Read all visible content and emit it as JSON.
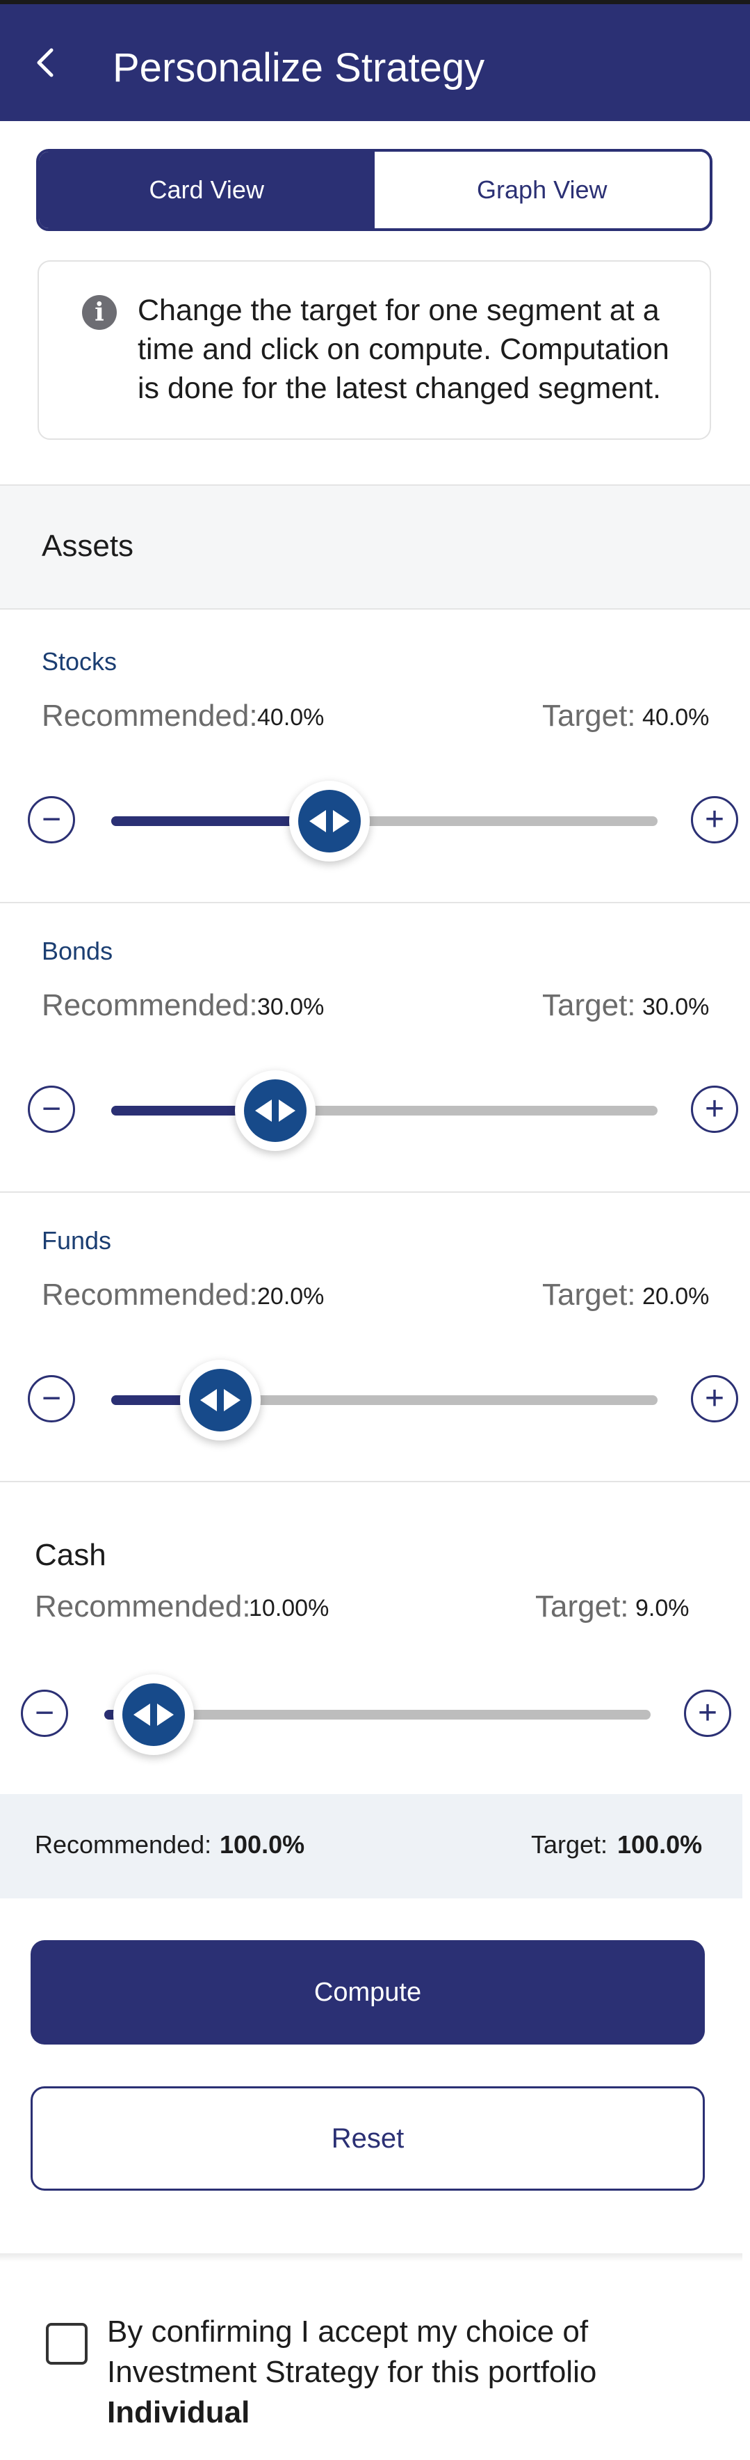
{
  "header": {
    "back_icon": "chevron-left-icon",
    "title": "Personalize Strategy"
  },
  "view_toggle": {
    "card_label": "Card View",
    "graph_label": "Graph View",
    "selected": "Card View"
  },
  "info": {
    "icon": "info-icon",
    "text": "Change the target for one segment at a time and click on compute. Computation is done for the latest changed segment."
  },
  "assets": {
    "title": "Assets",
    "recommended_label": "Recommended:",
    "target_label": "Target:",
    "segments": [
      {
        "name": "Stocks",
        "recommended": "40.0%",
        "target": "40.0%",
        "slider_value": 0.4
      },
      {
        "name": "Bonds",
        "recommended": "30.0%",
        "target": "30.0%",
        "slider_value": 0.3
      },
      {
        "name": "Funds",
        "recommended": "20.0%",
        "target": "20.0%",
        "slider_value": 0.2
      },
      {
        "name": "Cash",
        "recommended": "10.00%",
        "target": "9.0%",
        "slider_value": 0.09
      }
    ]
  },
  "totals": {
    "recommended_label": "Recommended:",
    "recommended_value": "100.0%",
    "target_label": "Target:",
    "target_value": "100.0%"
  },
  "actions": {
    "compute_label": "Compute",
    "reset_label": "Reset"
  },
  "confirm": {
    "text": "By confirming I accept my choice of Investment Strategy for this portfolio",
    "portfolio_name": "Individual",
    "checked": false
  },
  "colors": {
    "primary": "#2b3074",
    "thumb": "#174a8a",
    "segment_label": "#1b3e72",
    "track": "#bdbdbd"
  }
}
